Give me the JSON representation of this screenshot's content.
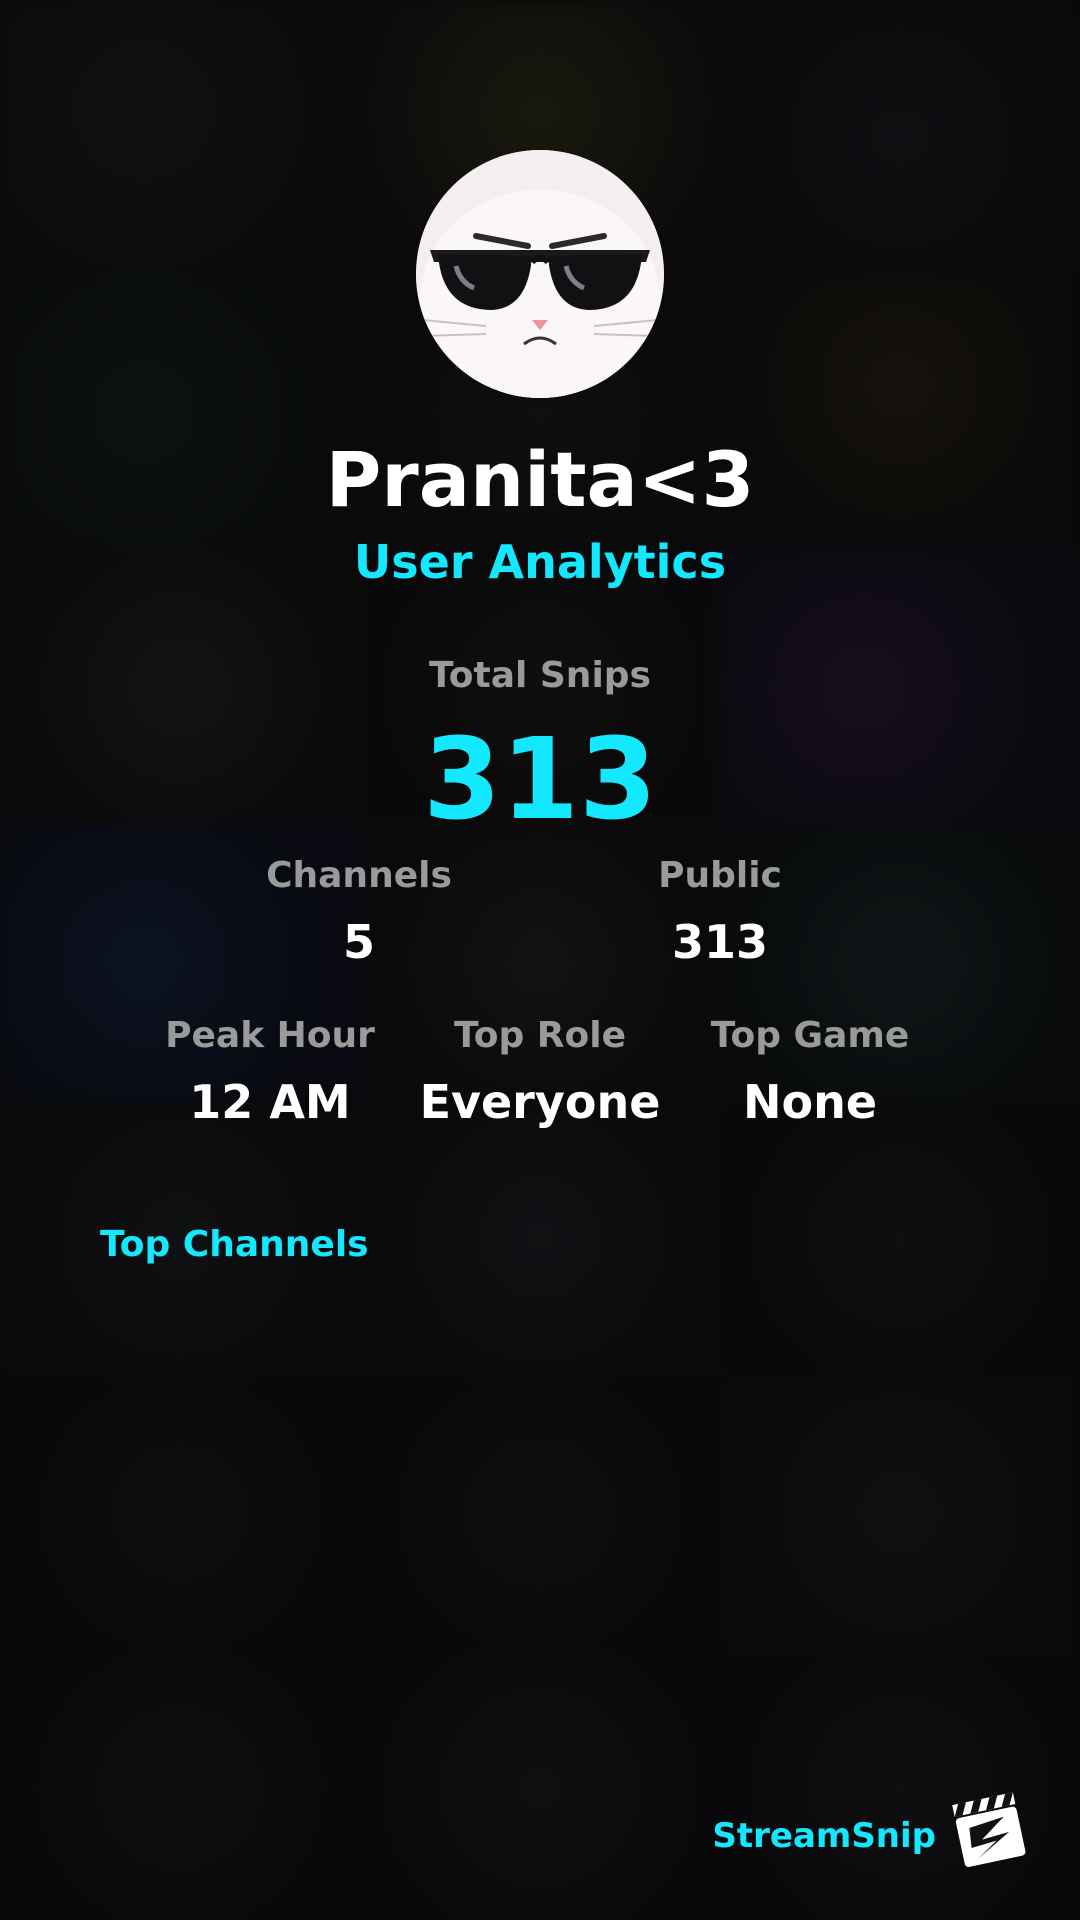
{
  "profile": {
    "username": "Pranita<3",
    "subtitle": "User Analytics",
    "avatar_icon": "cool-cat-sunglasses-avatar"
  },
  "stats": {
    "total": {
      "label": "Total Snips",
      "value": "313"
    },
    "channels": {
      "label": "Channels",
      "value": "5"
    },
    "public": {
      "label": "Public",
      "value": "313"
    },
    "peak_hour": {
      "label": "Peak Hour",
      "value": "12 AM"
    },
    "top_role": {
      "label": "Top Role",
      "value": "Everyone"
    },
    "top_game": {
      "label": "Top Game",
      "value": "None"
    }
  },
  "sections": {
    "top_channels_title": "Top Channels"
  },
  "branding": {
    "name": "StreamSnip",
    "logo_icon": "clapperboard-logo-icon"
  },
  "colors": {
    "accent": "#14e8ff",
    "label": "#9a9a9a",
    "value": "#ffffff",
    "background": "#0a0a0c"
  }
}
